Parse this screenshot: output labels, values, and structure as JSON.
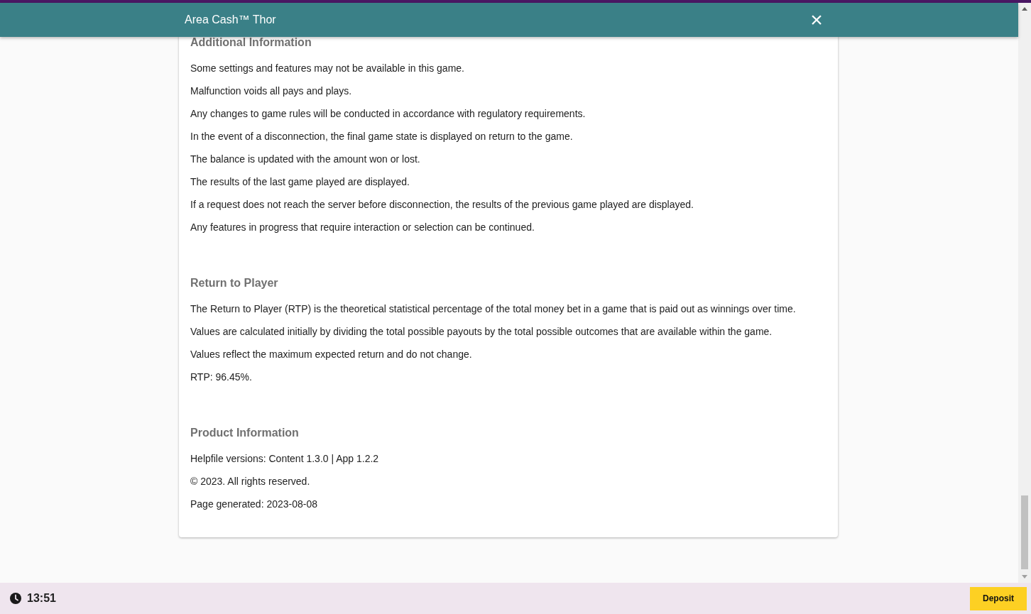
{
  "window": {
    "title": "Area Cash™ Thor",
    "close": "×"
  },
  "sections": [
    {
      "heading": "Additional Information",
      "lines": [
        "Some settings and features may not be available in this game.",
        "Malfunction voids all pays and plays.",
        "Any changes to game rules will be conducted in accordance with regulatory requirements.",
        "In the event of a disconnection, the final game state is displayed on return to the game.",
        "The balance is updated with the amount won or lost.",
        "The results of the last game played are displayed.",
        "If a request does not reach the server before disconnection, the results of the previous game played are displayed.",
        "Any features in progress that require interaction or selection can be continued."
      ]
    },
    {
      "heading": "Return to Player",
      "lines": [
        "The Return to Player (RTP) is the theoretical statistical percentage of the total money bet in a game that is paid out as winnings over time.",
        "Values are calculated initially by dividing the total possible payouts by the total possible outcomes that are available within the game.",
        "Values reflect the maximum expected return and do not change.",
        "RTP: 96.45%."
      ]
    },
    {
      "heading": "Product Information",
      "lines": [
        "Helpfile versions: Content 1.3.0 | App 1.2.2",
        "© 2023. All rights reserved.",
        "Page generated: 2023-08-08"
      ]
    }
  ],
  "footer": {
    "time": "13:51",
    "deposit": "Deposit"
  }
}
